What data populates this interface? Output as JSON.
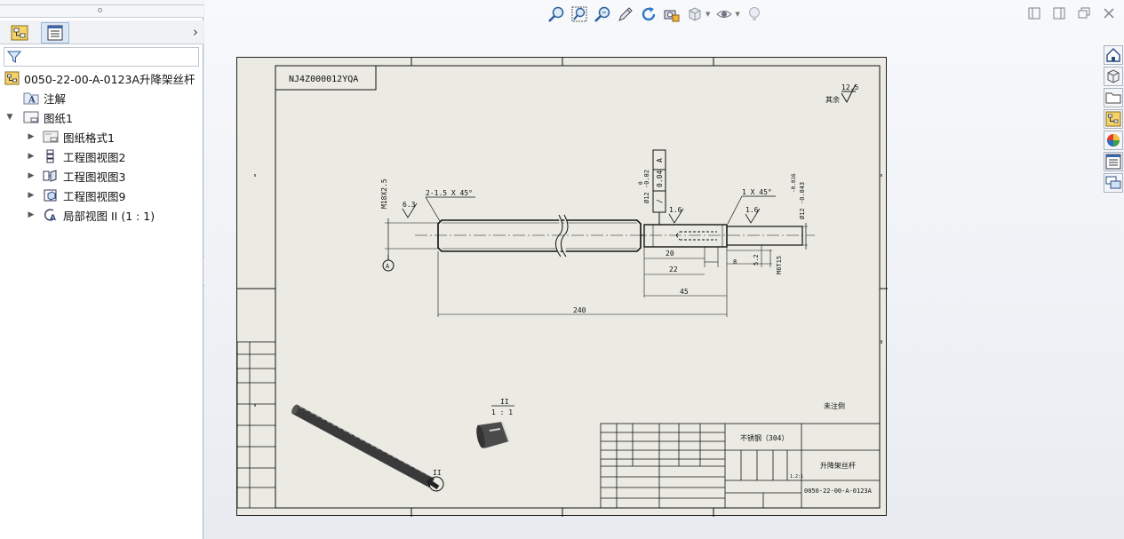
{
  "tree": {
    "root_label": "0050-22-00-A-0123A升降架丝杆",
    "annotations_label": "注解",
    "sheet_label": "图纸1",
    "sheet_format_label": "图纸格式1",
    "view2_label": "工程图视图2",
    "view3_label": "工程图视图3",
    "view9_label": "工程图视图9",
    "detail_view_label": "局部视图 II (1 : 1)"
  },
  "drawing": {
    "top_left_code": "NJ4Z000012YQA",
    "finish_remaining": "其余",
    "finish_value": "12.5",
    "chamfer_left": "2-1.5 X 45°",
    "chamfer_right": "1 X 45°",
    "rough_left": "6.3",
    "rough_mid": "1.6",
    "rough_right": "1.6",
    "thread_m": "M18X2.5",
    "tol_frame": {
      "symbol": "/",
      "value": "0.04",
      "datum": "A"
    },
    "dia_mid": "Ø12 -0.02",
    "dia_mid_upper": "0",
    "dia_right": "Ø12 -0.043",
    "dia_right_upper": "-0.016",
    "datum_label": "A",
    "dim_20": "20",
    "dim_22": "22",
    "dim_45": "45",
    "dim_240": "240",
    "dim_8": "8",
    "dim_5_2": "5.2",
    "dim_m6": "M6T15",
    "detail_label_top": "II",
    "detail_scale": "1 : 1",
    "leader_label": "II",
    "tech_req": "未注倒",
    "material": "不锈钢（304）",
    "part_name": "升降架丝杆",
    "drawing_no": "0050-22-00-A-0123A",
    "scale": "1.2:1"
  },
  "colors": {
    "sheet_bg": "#ebebe4",
    "line": "#111111",
    "accent": "#2d6cc0"
  }
}
